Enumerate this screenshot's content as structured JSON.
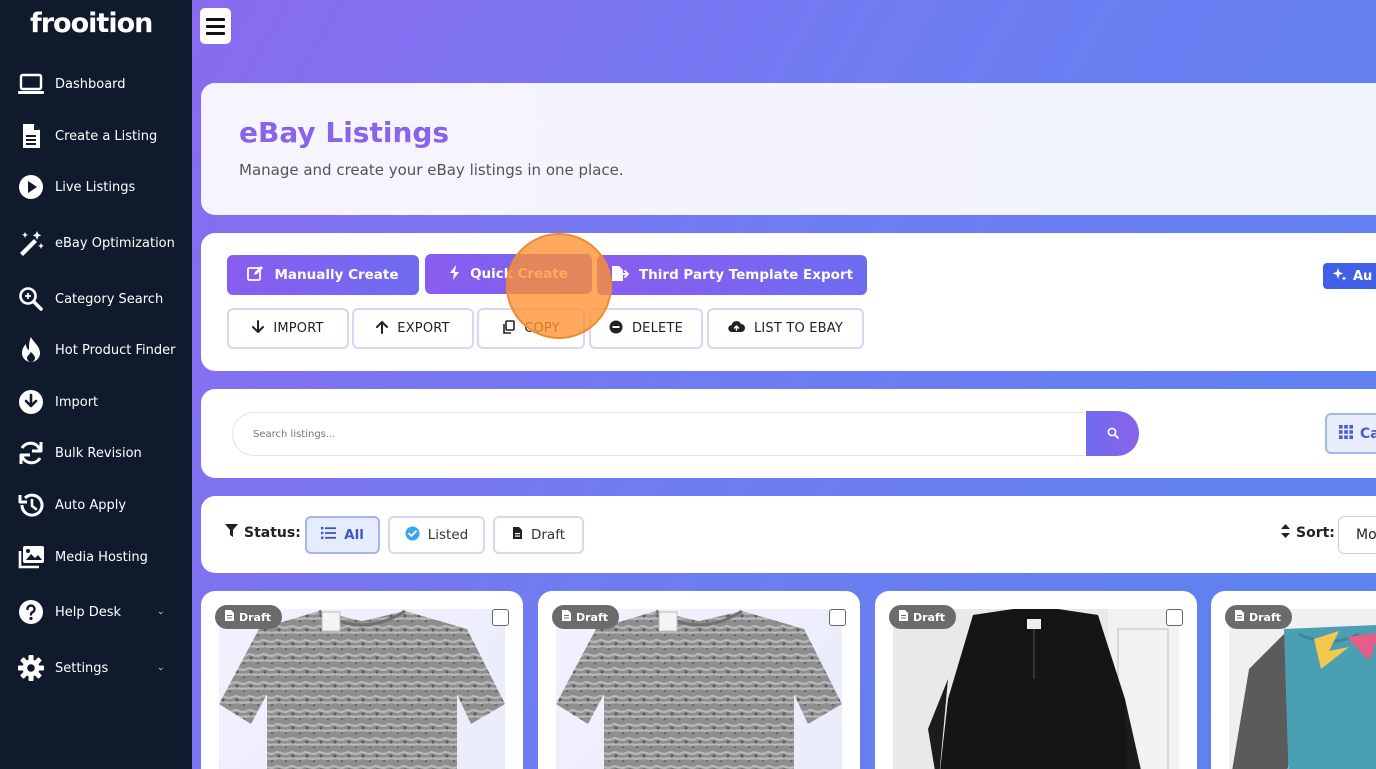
{
  "app": {
    "logo_text": "frooition"
  },
  "sidebar": {
    "items": [
      {
        "label": "Dashboard",
        "icon": "laptop-icon"
      },
      {
        "label": "Create a Listing",
        "icon": "document-icon"
      },
      {
        "label": "Live Listings",
        "icon": "play-circle-icon"
      },
      {
        "label": "eBay Optimization",
        "icon": "magic-wand-icon"
      },
      {
        "label": "Category Search",
        "icon": "search-tag-icon"
      },
      {
        "label": "Hot Product Finder",
        "icon": "fire-icon"
      },
      {
        "label": "Import",
        "icon": "download-circle-icon"
      },
      {
        "label": "Bulk Revision",
        "icon": "sync-icon"
      },
      {
        "label": "Auto Apply",
        "icon": "history-icon"
      },
      {
        "label": "Media Hosting",
        "icon": "images-icon"
      },
      {
        "label": "Help Desk",
        "icon": "question-circle-icon"
      },
      {
        "label": "Settings",
        "icon": "gear-icon"
      }
    ],
    "chevron": "⌄"
  },
  "header": {
    "title": "eBay Listings",
    "subtitle": "Manage and create your eBay listings in one place."
  },
  "actions": {
    "manually_create": "Manually Create",
    "quick_create": "Quick Create",
    "third_party_export": "Third Party Template Export",
    "ai_partial": "Au",
    "import": "IMPORT",
    "export": "EXPORT",
    "copy": "COPY",
    "delete": "DELETE",
    "list_to_ebay": "LIST TO EBAY"
  },
  "search": {
    "placeholder": "Search listings...",
    "view_toggle_partial": "Ca"
  },
  "filters": {
    "status_label": "Status:",
    "all": "All",
    "listed": "Listed",
    "draft": "Draft",
    "sort_label": "Sort:",
    "sort_value_partial": "Mo"
  },
  "listings": [
    {
      "status": "Draft",
      "image": "grey-acid-wash-tshirt"
    },
    {
      "status": "Draft",
      "image": "grey-acid-wash-tshirt"
    },
    {
      "status": "Draft",
      "image": "black-fleece-pullover"
    },
    {
      "status": "Draft",
      "image": "fox-racing-teal-shirt"
    }
  ],
  "colors": {
    "sidebar_bg": "#0f1b2d",
    "accent_purple": "#8a63e8",
    "accent_blue": "#5b83f0",
    "draft_badge": "#6b6b6b"
  }
}
